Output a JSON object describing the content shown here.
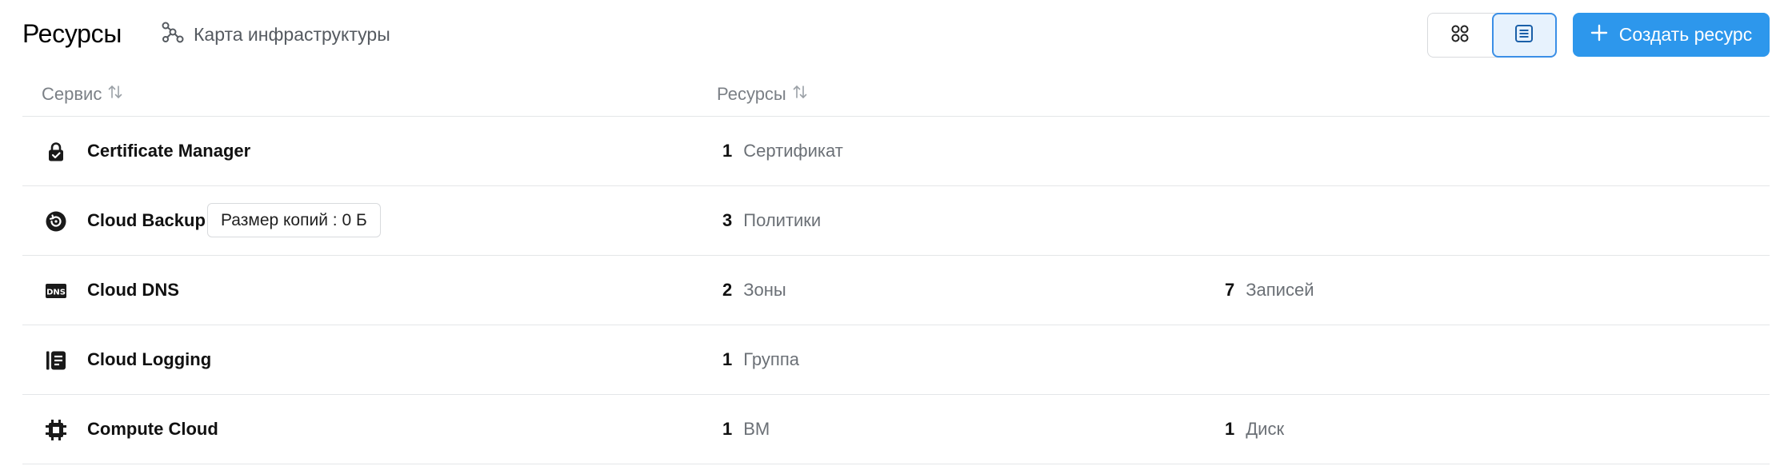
{
  "header": {
    "title": "Ресурсы",
    "infra_link": "Карта инфраструктуры",
    "create_button": "Создать ресурс",
    "view_mode": "list"
  },
  "colors": {
    "accent": "#2d97ec",
    "toggle_active_bg": "#e7f2fd",
    "muted_text": "#6b7076"
  },
  "table": {
    "columns": [
      "Сервис",
      "Ресурсы"
    ],
    "rows": [
      {
        "service": "Certificate Manager",
        "icon": "lock-icon",
        "resources": [
          {
            "count": "1",
            "unit": "Сертификат"
          }
        ]
      },
      {
        "service": "Cloud Backup",
        "icon": "backup-icon",
        "badge": "Размер копий : 0 Б",
        "resources": [
          {
            "count": "3",
            "unit": "Политики"
          }
        ]
      },
      {
        "service": "Cloud DNS",
        "icon": "dns-icon",
        "resources": [
          {
            "count": "2",
            "unit": "Зоны"
          },
          {
            "count": "7",
            "unit": "Записей"
          }
        ]
      },
      {
        "service": "Cloud Logging",
        "icon": "logging-icon",
        "resources": [
          {
            "count": "1",
            "unit": "Группа"
          }
        ]
      },
      {
        "service": "Compute Cloud",
        "icon": "chip-icon",
        "resources": [
          {
            "count": "1",
            "unit": "ВМ"
          },
          {
            "count": "1",
            "unit": "Диск"
          }
        ]
      }
    ]
  }
}
